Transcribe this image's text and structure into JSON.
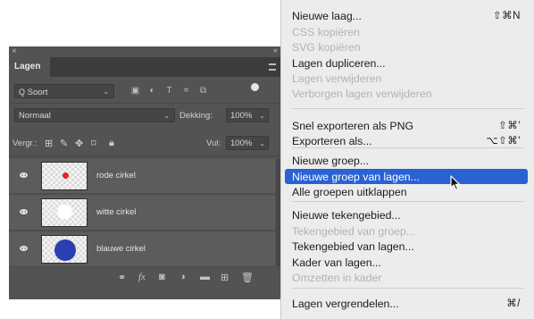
{
  "panel": {
    "close_glyph": "×",
    "collapse_glyph": "«",
    "tab_label": "Lagen",
    "filter": {
      "search_glyph": "Q",
      "kind_label": "Soort"
    },
    "blend": {
      "mode": "Normaal",
      "opacity_label": "Dekking:",
      "opacity_value": "100%"
    },
    "lock": {
      "label": "Vergr.:",
      "fill_label": "Vul:",
      "fill_value": "100%"
    },
    "layers": [
      {
        "name": "rode cirkel",
        "dot_color": "#e8202a"
      },
      {
        "name": "witte cirkel",
        "dot_color": "#ffffff"
      },
      {
        "name": "blauwe cirkel",
        "dot_color": "#2a3fb0"
      }
    ],
    "bottom_icons": [
      "link-icon",
      "fx-icon",
      "mask-icon",
      "adjustment-icon",
      "folder-icon",
      "new-layer-icon",
      "trash-icon"
    ],
    "fx_label": "fx"
  },
  "menu": {
    "accent": "#2a62d3",
    "items": [
      {
        "label": "Nieuwe laag...",
        "shortcut": "⇧⌘N",
        "enabled": true
      },
      {
        "label": "CSS kopiëren",
        "shortcut": "",
        "enabled": false
      },
      {
        "label": "SVG kopiëren",
        "shortcut": "",
        "enabled": false
      },
      {
        "label": "Lagen dupliceren...",
        "shortcut": "",
        "enabled": true
      },
      {
        "label": "Lagen verwijderen",
        "shortcut": "",
        "enabled": false
      },
      {
        "label": "Verborgen lagen verwijderen",
        "shortcut": "",
        "enabled": false
      },
      {
        "label": "Snel exporteren als PNG",
        "shortcut": "⇧⌘'",
        "enabled": true
      },
      {
        "label": "Exporteren als...",
        "shortcut": "⌥⇧⌘'",
        "enabled": true
      },
      {
        "label": "Nieuwe groep...",
        "shortcut": "",
        "enabled": true
      },
      {
        "label": "Nieuwe groep van lagen...",
        "shortcut": "",
        "enabled": true,
        "highlighted": true
      },
      {
        "label": "Alle groepen uitklappen",
        "shortcut": "",
        "enabled": true
      },
      {
        "label": "Nieuwe tekengebied...",
        "shortcut": "",
        "enabled": true
      },
      {
        "label": "Tekengebied van groep...",
        "shortcut": "",
        "enabled": false
      },
      {
        "label": "Tekengebied van lagen...",
        "shortcut": "",
        "enabled": true
      },
      {
        "label": "Kader van lagen...",
        "shortcut": "",
        "enabled": true
      },
      {
        "label": "Omzetten in kader",
        "shortcut": "",
        "enabled": false
      },
      {
        "label": "Lagen vergrendelen...",
        "shortcut": "⌘/",
        "enabled": true
      }
    ]
  }
}
